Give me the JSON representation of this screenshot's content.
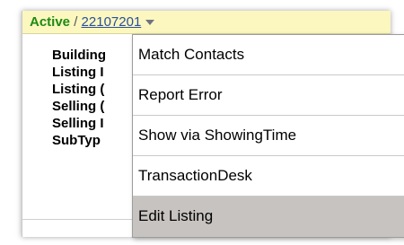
{
  "header": {
    "status": "Active",
    "separator": " / ",
    "listing_number": "22107201",
    "dropdown_icon": "chevron-down-icon"
  },
  "fields": [
    "Building",
    "Listing I",
    "Listing (",
    "Selling (",
    "Selling I",
    "SubTyp"
  ],
  "menu": {
    "items": [
      "Match Contacts",
      "Report Error",
      "Show via ShowingTime",
      "TransactionDesk",
      "Edit Listing"
    ],
    "highlighted_index": 4
  },
  "colors": {
    "status_green": "#1f8a12",
    "link_blue": "#2a4f9c",
    "header_bg": "#fbf7bf",
    "highlight_bg": "#c7c3c0"
  }
}
